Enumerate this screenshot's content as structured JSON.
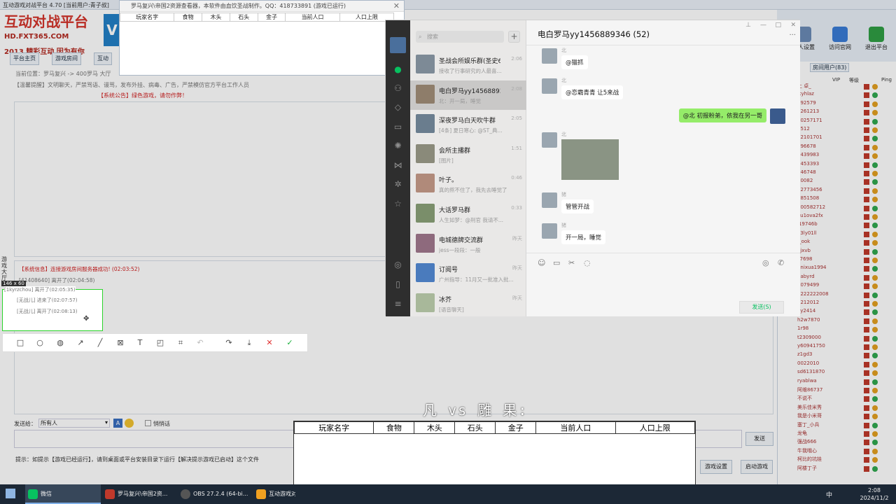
{
  "bg_app": {
    "title": "互动游戏对战平台 4.70 [当前用户:青子叔]",
    "logo_main": "互动对战平台",
    "logo_url": "HD.FXT365.COM",
    "logo_slogan": "2013 精彩互动 因为有你",
    "nav": [
      "平台主页",
      "游戏房间",
      "互动"
    ],
    "breadcrumb": "当前位置：罗马复兴 -> 400罗马 大厅",
    "notice": "【温馨提醒】文明聊天，严禁骂语、谩骂，发布外挂、病毒、广告，严禁模仿官方平台工作人员",
    "notice_red": "【系统公告】绿色游戏，请勿作弊！",
    "side_tab": "游戏大厅",
    "sys_msgs": [
      "【系统信息】连接游戏房间服务器成功! (02:03:52)",
      "[41408640] 离开了(02:04:58)",
      "[1kyrzchou] 离开了(02:05:35)",
      "[无战儿] 进来了(02:07:57)",
      "[无战儿] 离开了(02:08:13)"
    ],
    "send_to_label": "发送给：",
    "send_to_value": "所有人",
    "private_chat": "悄悄话",
    "send_button": "发送",
    "hint": "提示：如提示【游戏已经运行】，请到桌面或平台安装目录下运行【解决提示游戏已启动】这个文件",
    "game_settings": "游戏设置",
    "launch_game": "启动游戏",
    "right_icons": [
      "个人设置",
      "访问官网",
      "退出平台"
    ],
    "right_tab": "房间用户(83)",
    "right_cols": [
      "VIP",
      "等级",
      "Ping"
    ],
    "right_users": [
      "上 卓_",
      "ttyhlaz",
      "792579",
      "0261213",
      "40257171",
      "9512",
      "12101701",
      "096678",
      "0439983",
      "3453393",
      "746748",
      "50082",
      "82773456",
      "8851508",
      "600582712",
      "xu1ova2fx",
      "j19746b",
      "a3ly01ll",
      "J_ook",
      "ajxvb",
      "z7698",
      "nnixua1994",
      "4abyrd",
      "2079499",
      "0222222008",
      "1212012",
      "oy2414",
      "h2w7870",
      "1r98",
      "t2309000",
      "y60941750",
      "z1gd3",
      "0022010",
      "sd6131870",
      "ryablwa",
      "阿维86737",
      "不说不",
      "美乐佳米秀",
      "我是小米哥",
      "塞丁_小兵",
      "龙龟",
      "强战666",
      "牛我哦心",
      "柯比的坑娃",
      "阿楼丁子"
    ]
  },
  "resources_window": {
    "title": "罗马复兴\\帝国2资源查看器，本软件由血饮圣战制作。QQ：418733891 (游戏已运行)",
    "columns": [
      "玩家名字",
      "食物",
      "木头",
      "石头",
      "金子",
      "当前人口",
      "人口上限"
    ]
  },
  "wechat": {
    "search_placeholder": "搜索",
    "chat_title": "电白罗马yy1456889346 (52)",
    "conversations": [
      {
        "name": "圣战会所娱乐群(圣史6...",
        "time": "2:06",
        "preview": "接收了行事研究的人最喜..."
      },
      {
        "name": "电白罗马yy14568893...",
        "time": "2:08",
        "preview": "北：开一局，睡觉"
      },
      {
        "name": "深夜罗马白天吹牛群",
        "time": "2:05",
        "preview": "[4条] 夏日寒心: @ST_典..."
      },
      {
        "name": "会所主播群",
        "time": "1:51",
        "preview": "[图片]"
      },
      {
        "name": "叶子。",
        "time": "0:46",
        "preview": "真的熬不住了，我先去睡觉了"
      },
      {
        "name": "大话罗马群",
        "time": "0:33",
        "preview": "人生如梦：@刑官 我请不..."
      },
      {
        "name": "电城德牌交流群",
        "time": "昨天",
        "preview": "jess一段段：一般"
      },
      {
        "name": "订阅号",
        "time": "昨天",
        "preview": "广州指导：11月又一批准入批..."
      },
      {
        "name": "冰芥",
        "time": "昨天",
        "preview": "[语音聊天]"
      }
    ],
    "messages": [
      {
        "sender": "北",
        "text": "@猫抓",
        "me": false
      },
      {
        "sender": "北",
        "text": "@恋霸青青 让5来战",
        "me": false
      },
      {
        "sender": "",
        "text": "@北 初报粉弟，依我在另一哥",
        "me": true
      },
      {
        "sender": "北",
        "text": "[图片]",
        "me": false
      },
      {
        "sender": "猪",
        "text": "管管开战",
        "me": false
      },
      {
        "sender": "猪",
        "text": "开一局，睡觉",
        "me": false
      }
    ],
    "send_button": "发送(S)"
  },
  "snip": {
    "size_label": "146 x 60",
    "tools": [
      "rect",
      "ellipse",
      "mosaic",
      "arrow",
      "line",
      "blur",
      "text",
      "marker",
      "ocr",
      "undo",
      "share",
      "save",
      "cancel",
      "done"
    ]
  },
  "score": {
    "title": "凡 vs  雕  果:",
    "columns": [
      "玩家名字",
      "食物",
      "木头",
      "石头",
      "金子",
      "当前人口",
      "人口上限"
    ]
  },
  "taskbar": {
    "items": [
      "微信",
      "罗马复兴\\帝国2资...",
      "OBS 27.2.4 (64-bi...",
      "互动游戏对战..."
    ],
    "time": "2:08",
    "date": "2024/11/2",
    "ime": "中"
  }
}
